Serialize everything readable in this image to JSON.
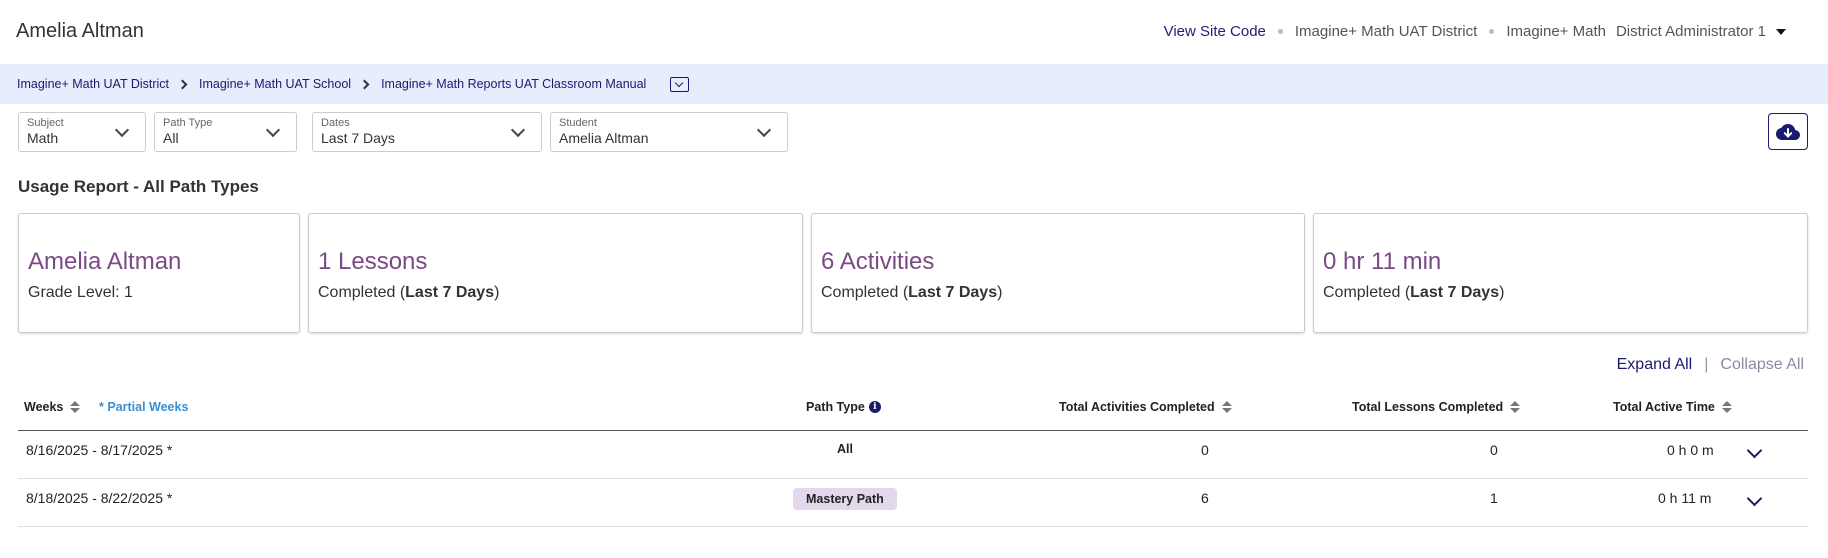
{
  "header": {
    "title": "Amelia Altman",
    "view_site_code": "View Site Code",
    "district": "Imagine+ Math UAT District",
    "product": "Imagine+ Math",
    "user": "District Administrator 1"
  },
  "breadcrumb": [
    "Imagine+ Math UAT District",
    "Imagine+ Math UAT School",
    "Imagine+ Math Reports UAT Classroom Manual"
  ],
  "filters": {
    "subject": {
      "label": "Subject",
      "value": "Math"
    },
    "path_type": {
      "label": "Path Type",
      "value": "All"
    },
    "dates": {
      "label": "Dates",
      "value": "Last 7 Days"
    },
    "student": {
      "label": "Student",
      "value": "Amelia Altman"
    }
  },
  "report_title": "Usage Report  - All Path Types",
  "cards": [
    {
      "big": "Amelia Altman",
      "sub": "Grade Level: 1"
    },
    {
      "big": "1 Lessons",
      "sub_prefix": "Completed (",
      "sub_bold": "Last 7 Days",
      "sub_suffix": ")"
    },
    {
      "big": "6 Activities",
      "sub_prefix": "Completed (",
      "sub_bold": "Last 7 Days",
      "sub_suffix": ")"
    },
    {
      "big": "0 hr 11 min",
      "sub_prefix": "Completed (",
      "sub_bold": "Last 7 Days",
      "sub_suffix": ")"
    }
  ],
  "controls": {
    "expand_all": "Expand All",
    "separator": "|",
    "collapse_all": "Collapse All"
  },
  "table": {
    "headers": {
      "weeks": "Weeks",
      "partial": "* Partial Weeks",
      "path_type": "Path Type",
      "activities": "Total Activities Completed",
      "lessons": "Total Lessons Completed",
      "time": "Total Active Time"
    },
    "rows": [
      {
        "weeks": "8/16/2025 - 8/17/2025 *",
        "path_type": "All",
        "activities": "0",
        "lessons": "0",
        "time": "0 h 0 m"
      },
      {
        "weeks": "8/18/2025 - 8/22/2025 *",
        "path_type": "Mastery Path",
        "activities": "6",
        "lessons": "1",
        "time": "0 h 11 m"
      }
    ]
  },
  "colors": {
    "accent": "#1a1a6e",
    "card_title": "#7b4a86",
    "breadcrumb_bg": "#e6edfc",
    "pill_bg": "#e3d7ec"
  },
  "icons": [
    "chevron-right-icon",
    "collapse-toggle-icon",
    "chevron-down-icon",
    "cloud-download-icon",
    "sort-icon",
    "info-icon",
    "caret-down-icon"
  ]
}
